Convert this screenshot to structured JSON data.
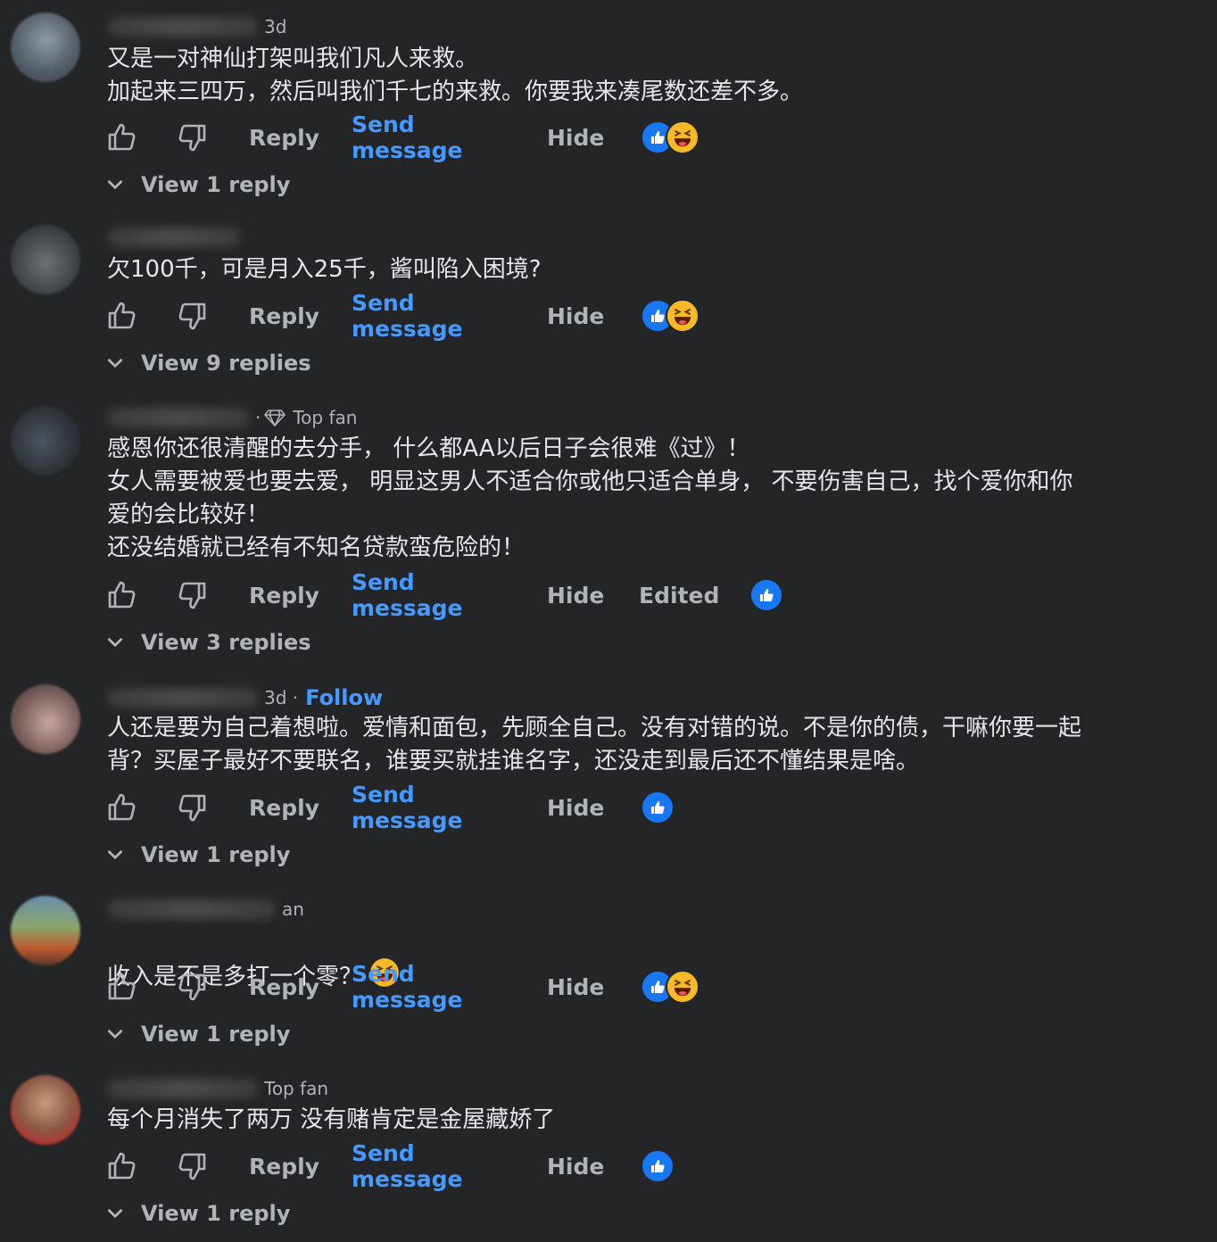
{
  "labels": {
    "reply": "Reply",
    "send_message": "Send message",
    "hide": "Hide",
    "edited": "Edited",
    "follow": "Follow",
    "top_fan": "Top fan"
  },
  "comments": [
    {
      "meta_time": "3d",
      "body": "又是一对神仙打架叫我们凡人来救。\n加起来三四万，然后叫我们千七的来救。你要我来凑尾数还差不多。",
      "reactions": [
        "like",
        "haha"
      ],
      "view_replies": "View 1 reply"
    },
    {
      "body": "欠100千，可是月入25千，酱叫陷入困境?",
      "reactions": [
        "like",
        "haha"
      ],
      "view_replies": "View 9 replies"
    },
    {
      "badge": "Top fan",
      "body": "感恩你还很清醒的去分手， 什么都AA以后日子会很难《过》！\n女人需要被爱也要去爱， 明显这男人不适合你或他只适合单身， 不要伤害自己，找个爱你和你\n爱的会比较好！\n还没结婚就已经有不知名贷款蛮危险的！",
      "reactions": [
        "like"
      ],
      "edited": "Edited",
      "view_replies": "View 3 replies"
    },
    {
      "meta_time": "3d ·",
      "follow": "Follow",
      "body": "人还是要为自己着想啦。爱情和面包，先顾全自己。没有对错的说。不是你的债，干嘛你要一起\n背？买屋子最好不要联名，谁要买就挂谁名字，还没走到最后还不懂结果是啥。",
      "reactions": [
        "like"
      ],
      "view_replies": "View 1 reply"
    },
    {
      "meta_partial": "an",
      "body": "收入是不是多打一个零？",
      "reactions": [
        "like",
        "haha"
      ],
      "view_replies": "View 1 reply"
    },
    {
      "badge": "Top fan",
      "body": "每个月消失了两万 没有赌肯定是金屋藏娇了",
      "reactions": [
        "like"
      ],
      "view_replies": "View 1 reply"
    }
  ],
  "colors": {
    "background": "#242526",
    "text": "#e4e6eb",
    "secondary": "#b0b3b8",
    "link": "#4599ff",
    "like": "#1877f2",
    "haha": "#f7b928"
  }
}
